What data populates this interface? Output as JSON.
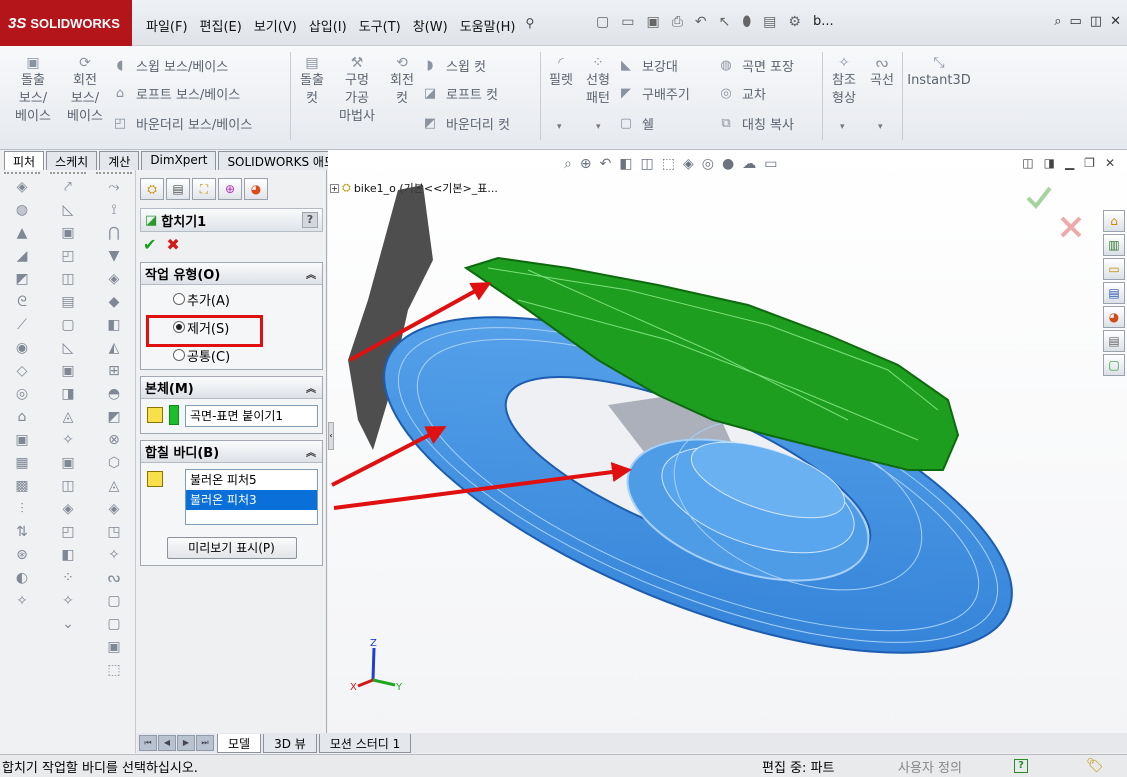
{
  "app": {
    "logo_mark": "3S",
    "logo_text": "SOLIDWORKS"
  },
  "menu": [
    "파일(F)",
    "편집(E)",
    "보기(V)",
    "삽입(I)",
    "도구(T)",
    "창(W)",
    "도움말(H)"
  ],
  "title_short": "b...",
  "ribbon": {
    "features": {
      "extrude_boss": [
        "돌출",
        "보스/",
        "베이스"
      ],
      "revolve_boss": [
        "회전",
        "보스/",
        "베이스"
      ],
      "sweep_boss": "스윕 보스/베이스",
      "loft_boss": "로프트 보스/베이스",
      "boundary_boss": "바운더리 보스/베이스",
      "extrude_cut": [
        "돌출",
        "컷"
      ],
      "hole_wizard": [
        "구멍",
        "가공",
        "마법사"
      ],
      "revolve_cut": [
        "회전",
        "컷"
      ],
      "sweep_cut": "스윕 컷",
      "loft_cut": "로프트 컷",
      "boundary_cut": "바운더리 컷",
      "fillet": "필렛",
      "linear_pattern": [
        "선형",
        "패턴"
      ],
      "rib": "보강대",
      "draft": "구배주기",
      "shell": "쉘",
      "wrap": "곡면 포장",
      "intersect": "교차",
      "mirror": "대칭 복사",
      "ref_geometry": [
        "참조",
        "형상"
      ],
      "curves": "곡선",
      "instant3d": "Instant3D"
    }
  },
  "command_tabs": [
    "피처",
    "스케치",
    "계산",
    "DimXpert",
    "SOLIDWORKS 애드인"
  ],
  "property_manager": {
    "title": "합치기1",
    "help": "?",
    "ok_glyph": "✔",
    "cancel_glyph": "✖",
    "operation_type": {
      "label": "작업 유형(O)",
      "options": [
        "추가(A)",
        "제거(S)",
        "공통(C)"
      ],
      "selected": "제거(S)"
    },
    "main_body": {
      "label": "본체(M)",
      "value": "곡면-표면 붙이기1"
    },
    "bodies_to_combine": {
      "label": "합칠 바디(B)",
      "items": [
        "불러온 피처5",
        "불러온 피처3"
      ],
      "selected": "불러온 피처3"
    },
    "preview_button": "미리보기 표시(P)"
  },
  "graphics": {
    "tree_item": "bike1_o  (기본<<기본>_표...",
    "triad_labels": {
      "x": "X",
      "y": "Y",
      "z": "Z"
    },
    "colors": {
      "green_body": "#1e9e1e",
      "blue_body": "#3a8ee0",
      "arrow": "#e01010",
      "gray_body": "#a7acb6"
    }
  },
  "bottom_tabs": [
    "모델",
    "3D 뷰",
    "모션 스터디 1"
  ],
  "status": {
    "message": "합치기 작업할 바디를 선택하십시오.",
    "editing": "편집 중: 파트",
    "custom": "사용자 정의",
    "help": "?"
  }
}
